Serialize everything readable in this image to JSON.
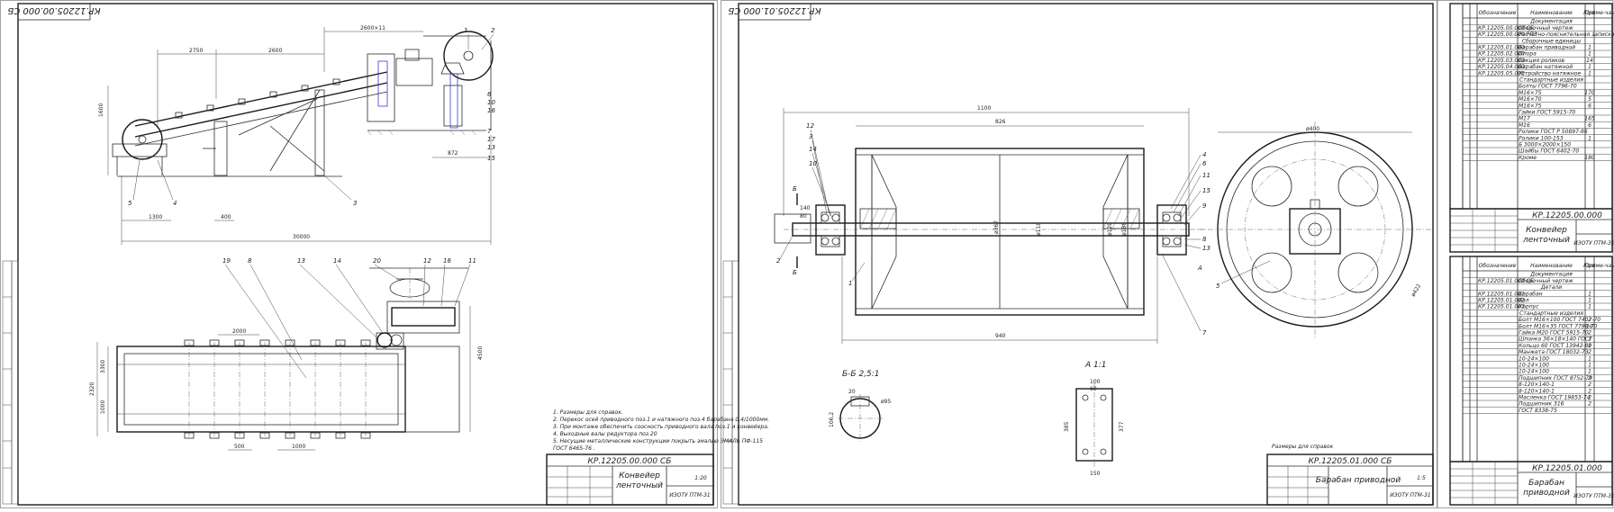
{
  "sheet1": {
    "stamp_rotated": "КР.12205.00.000 СБ",
    "doc_code": "КР.12205.00.000 СБ",
    "title_line1": "Конвейер",
    "title_line2": "ленточный",
    "scale": "1:20",
    "org": "ИЗОТУ ПТМ-31",
    "notes": [
      "1. Размеры для справок.",
      "2. Перекос осей приводного поз.1 и натяжного поз.4 барабана 0,4/1000мм.",
      "3. При монтаже обеспечить соосность приводного вала поз.1 и конвейера.",
      "4. Выходные валы редуктора поз.20",
      "5. Несущие металлические конструкции покрыть эмалью ЭМАЛЬ ПФ-115",
      "   ГОСТ 6465-76 ."
    ],
    "dims": [
      "2750",
      "2600",
      "2600×11",
      "1600",
      "1300",
      "400",
      "872",
      "30000",
      "2000",
      "3300",
      "2320",
      "1000",
      "500",
      "1000",
      "4500"
    ],
    "callouts": [
      "1",
      "2",
      "3",
      "4",
      "5",
      "6",
      "10",
      "16",
      "7",
      "17",
      "13",
      "15",
      "19",
      "8",
      "13",
      "14",
      "20",
      "12",
      "16",
      "11"
    ]
  },
  "sheet2": {
    "stamp_rotated": "КР.12205.01.000 СБ",
    "doc_code": "КР.12205.01.000 СБ",
    "title_line1": "Барабан приводной",
    "scale": "1:5",
    "org": "ИЗОТУ ПТМ-31",
    "dims": [
      "1100",
      "826",
      "940",
      "ø400",
      "ø422",
      "ø367",
      "ø110",
      "ø120",
      "ø180",
      "140",
      "80"
    ],
    "section_label": "Б-Б 2,5:1",
    "view_label": "А 1:1",
    "section_dims": [
      "20",
      "ø95",
      "106,2"
    ],
    "view_dims": [
      "100",
      "60",
      "385",
      "377",
      "150"
    ],
    "callouts": [
      "12",
      "3",
      "14",
      "10",
      "2",
      "1",
      "4",
      "6",
      "11",
      "15",
      "9",
      "8",
      "13",
      "7",
      "5",
      "Б",
      "Б",
      "А"
    ],
    "note": "Размеры для справок"
  },
  "spec1": {
    "headers": [
      "Обозначение",
      "Наименование",
      "Кол.",
      "Приме-чание"
    ],
    "sections": [
      {
        "title": "Документация",
        "rows": [
          [
            "КР.12205.00.000 СБ",
            "Сборочный чертеж",
            ""
          ],
          [
            "КР.12205.00.000 РПЗ",
            "Расчетно-пояснительная записка",
            ""
          ]
        ]
      },
      {
        "title": "Сборочные единицы",
        "rows": [
          [
            "КР.12205.01.000",
            "Барабан приводной",
            "1"
          ],
          [
            "КР.12205.02.000",
            "Опора",
            "1"
          ],
          [
            "КР.12205.03.000",
            "Секция роликов",
            "14"
          ],
          [
            "КР.12205.04.000",
            "Барабан натяжной",
            "1"
          ],
          [
            "КР.12205.05.000",
            "Устройство натяжное",
            "1"
          ]
        ]
      },
      {
        "title": "Стандартные изделия",
        "rows": [
          [
            "",
            "Болты ГОСТ 7796-70",
            ""
          ],
          [
            "",
            "М16×75",
            "170"
          ],
          [
            "",
            "М16×70",
            "5"
          ],
          [
            "",
            "М16×75",
            "6"
          ],
          [
            "",
            "Гайки ГОСТ 5915-70",
            ""
          ],
          [
            "",
            "М17",
            "165"
          ],
          [
            "",
            "М16",
            "6"
          ],
          [
            "",
            "Ролики ГОСТ Р 50897-96",
            ""
          ],
          [
            "",
            "Ролики 100-153",
            "1"
          ],
          [
            "",
            "Б 3000×2000×150",
            ""
          ],
          [
            "",
            "Шайбы ГОСТ 6402-70",
            ""
          ],
          [
            "",
            "Кроме",
            "180"
          ]
        ]
      }
    ],
    "tb_code": "КР.12205.00.000",
    "tb_title1": "Конвейер",
    "tb_title2": "ленточный",
    "tb_org": "ИЗОТУ ПТМ-31"
  },
  "spec2": {
    "headers": [
      "Обозначение",
      "Наименование",
      "Кол.",
      "Приме-чание"
    ],
    "sections": [
      {
        "title": "Документация",
        "rows": [
          [
            "КР.12205.01.000 СБ",
            "Сборочный чертеж",
            ""
          ]
        ]
      },
      {
        "title": "Детали",
        "rows": [
          [
            "КР.12205.01.001",
            "Барабан",
            "1"
          ],
          [
            "КР.12205.01.002",
            "Вал",
            "1"
          ],
          [
            "КР.12205.01.003",
            "Корпус",
            "1"
          ]
        ]
      },
      {
        "title": "Стандартные изделия",
        "rows": [
          [
            "",
            "Болт М16×100 ГОСТ 7402-70",
            "2"
          ],
          [
            "",
            "Болт М16×35 ГОСТ 7798-70",
            "10"
          ],
          [
            "",
            "Гайка М20 ГОСТ 5915-70",
            "2"
          ],
          [
            "",
            "Шпонка 36×18×140 ГОСТ",
            "1"
          ],
          [
            "",
            "Кольцо 60 ГОСТ 13942-80",
            "1"
          ],
          [
            "",
            "Манжета ГОСТ 18032-73",
            "2"
          ],
          [
            "",
            "10-24×100",
            "1"
          ],
          [
            "",
            "10-24×100",
            "1"
          ],
          [
            "",
            "10-24×100",
            "1"
          ],
          [
            "",
            "Подшипник ГОСТ 8752-79",
            "2"
          ],
          [
            "",
            "8-120×140-1",
            "2"
          ],
          [
            "",
            "8-120×140-1",
            "2"
          ],
          [
            "",
            "Масленка ГОСТ 19853-74",
            "2"
          ],
          [
            "",
            "Подшипник 316",
            "2"
          ],
          [
            "",
            "ГОСТ 8338-75",
            ""
          ]
        ]
      }
    ],
    "tb_code": "КР.12205.01.000",
    "tb_title1": "Барабан",
    "tb_title2": "приводной",
    "tb_org": "ИЗОТУ ПТМ-31"
  }
}
